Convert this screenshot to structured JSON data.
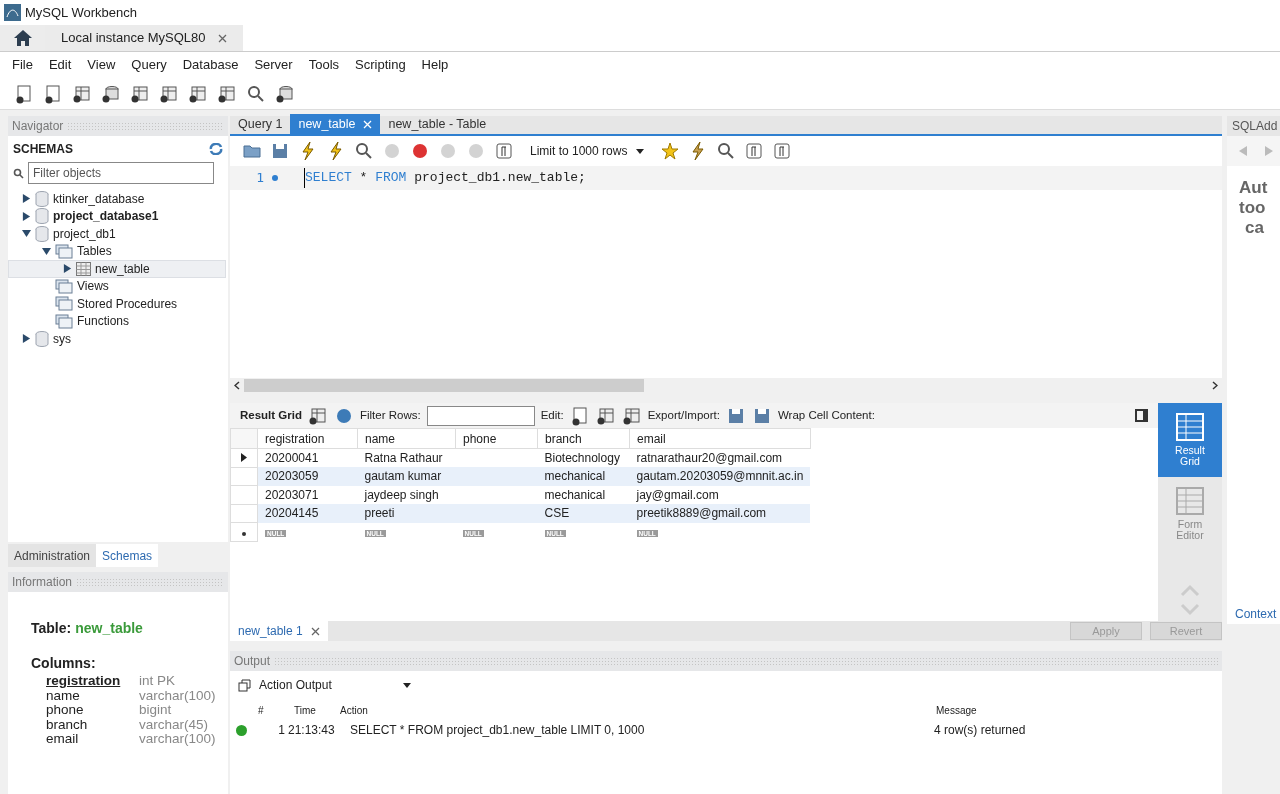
{
  "window": {
    "title": "MySQL Workbench"
  },
  "connection_tabs": [
    {
      "label": "Local instance MySQL80",
      "selected": true
    }
  ],
  "menu": [
    "File",
    "Edit",
    "View",
    "Query",
    "Database",
    "Server",
    "Tools",
    "Scripting",
    "Help"
  ],
  "navigator": {
    "title": "Navigator",
    "schemas_heading": "SCHEMAS",
    "filter": {
      "placeholder": "Filter objects"
    },
    "tree": [
      {
        "label": "ktinker_database",
        "kind": "schema",
        "expanded": false,
        "bold": false,
        "selected": false
      },
      {
        "label": "project_database1",
        "kind": "schema",
        "expanded": false,
        "bold": true,
        "selected": false
      },
      {
        "label": "project_db1",
        "kind": "schema",
        "expanded": true,
        "bold": false,
        "selected": false,
        "children": [
          {
            "label": "Tables",
            "kind": "folder",
            "expanded": true,
            "bold": false,
            "selected": false,
            "children": [
              {
                "label": "new_table",
                "kind": "table",
                "expanded": false,
                "bold": false,
                "selected": true
              }
            ]
          },
          {
            "label": "Views",
            "kind": "folder",
            "bold": false,
            "selected": false
          },
          {
            "label": "Stored Procedures",
            "kind": "folder",
            "bold": false,
            "selected": false
          },
          {
            "label": "Functions",
            "kind": "folder",
            "bold": false,
            "selected": false
          }
        ]
      },
      {
        "label": "sys",
        "kind": "schema",
        "expanded": false,
        "bold": false,
        "selected": false
      }
    ]
  },
  "sidebar_tabs": [
    {
      "label": "Administration",
      "selected": false
    },
    {
      "label": "Schemas",
      "selected": true
    }
  ],
  "information": {
    "title": "Information",
    "table_label": "Table:",
    "table_name": "new_table",
    "columns_label": "Columns:",
    "columns": [
      {
        "name": "registration",
        "type": "int PK",
        "primary": true
      },
      {
        "name": "name",
        "type": "varchar(100)",
        "primary": false
      },
      {
        "name": "phone",
        "type": "bigint",
        "primary": false
      },
      {
        "name": "branch",
        "type": "varchar(45)",
        "primary": false
      },
      {
        "name": "email",
        "type": "varchar(100)",
        "primary": false
      }
    ]
  },
  "editor_tabs": [
    {
      "label": "Query 1",
      "selected": false
    },
    {
      "label": "new_table",
      "selected": true
    },
    {
      "label": "new_table - Table",
      "selected": false
    }
  ],
  "query_toolbar": {
    "limit": "Limit to 1000 rows"
  },
  "editor": {
    "lines": [
      {
        "number": "1",
        "tokens": [
          {
            "text": "SELECT",
            "kind": "keyword"
          },
          {
            "text": " * ",
            "kind": "plain"
          },
          {
            "text": "FROM",
            "kind": "keyword"
          },
          {
            "text": " project_db1.new_table;",
            "kind": "plain"
          }
        ]
      }
    ]
  },
  "results": {
    "tab_label": "Result Grid",
    "filter_label": "Filter Rows:",
    "edit_label": "Edit:",
    "export_label": "Export/Import:",
    "wrap_label": "Wrap Cell Content:",
    "columns": [
      "registration",
      "name",
      "phone",
      "branch",
      "email"
    ],
    "rows": [
      {
        "current": true,
        "cells": [
          "20200041",
          "Ratna Rathaur",
          null,
          "Biotechnology",
          "ratnarathaur20@gmail.com"
        ]
      },
      {
        "current": false,
        "cells": [
          "20203059",
          "gautam kumar",
          null,
          "mechanical",
          "gautam.20203059@mnnit.ac.in"
        ]
      },
      {
        "current": false,
        "cells": [
          "20203071",
          "jaydeep singh",
          null,
          "mechanical",
          "jay@gmail.com"
        ]
      },
      {
        "current": false,
        "cells": [
          "20204145",
          "preeti",
          null,
          "CSE",
          "preetik8889@gmail.com"
        ]
      }
    ],
    "null_labels": [
      "NULL",
      "NULL",
      "NULL",
      "NULL",
      "NULL"
    ],
    "side_buttons": [
      {
        "label": "Result Grid",
        "selected": true
      },
      {
        "label": "Form Editor",
        "selected": false
      }
    ]
  },
  "result_tabs": [
    {
      "label": "new_table 1",
      "selected": true
    }
  ],
  "apply_button": "Apply",
  "revert_button": "Revert",
  "context_tab": "Context",
  "output": {
    "title": "Output",
    "selector": "Action Output",
    "columns": [
      "#",
      "Time",
      "Action",
      "Message"
    ],
    "rows": [
      {
        "success": true,
        "number": "1",
        "time": "21:13:43",
        "action": "SELECT * FROM project_db1.new_table LIMIT 0, 1000",
        "message": "4 row(s) returned"
      }
    ]
  },
  "sql_additions": {
    "title": "SQLAdd",
    "text_lines": [
      "Aut",
      "too",
      "ca"
    ]
  }
}
